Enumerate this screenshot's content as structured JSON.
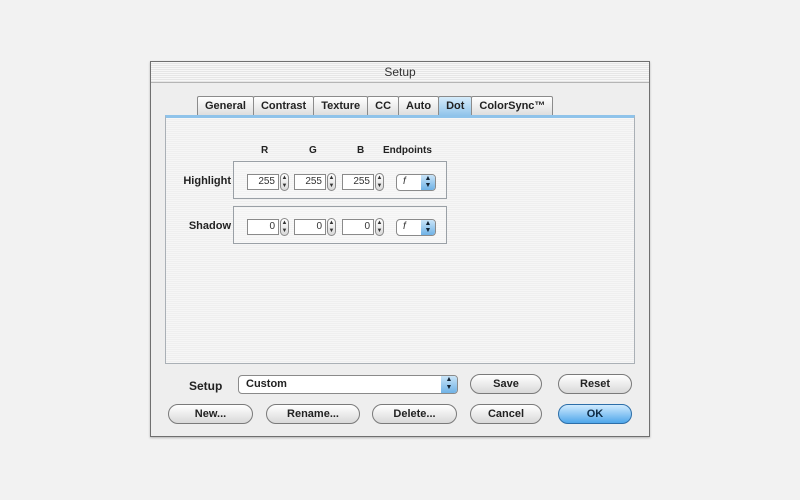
{
  "window": {
    "title": "Setup"
  },
  "tabs": [
    {
      "label": "General",
      "active": false
    },
    {
      "label": "Contrast",
      "active": false
    },
    {
      "label": "Texture",
      "active": false
    },
    {
      "label": "CC",
      "active": false
    },
    {
      "label": "Auto",
      "active": false
    },
    {
      "label": "Dot",
      "active": true
    },
    {
      "label": "ColorSync™",
      "active": false
    }
  ],
  "dot_panel": {
    "columns": {
      "r": "R",
      "g": "G",
      "b": "B",
      "endpoints": "Endpoints"
    },
    "highlight": {
      "label": "Highlight",
      "r": "255",
      "g": "255",
      "b": "255",
      "endpoint": "f"
    },
    "shadow": {
      "label": "Shadow",
      "r": "0",
      "g": "0",
      "b": "0",
      "endpoint": "f"
    }
  },
  "setup": {
    "label": "Setup",
    "selected": "Custom"
  },
  "buttons": {
    "save": "Save",
    "reset": "Reset",
    "new": "New...",
    "rename": "Rename...",
    "delete": "Delete...",
    "cancel": "Cancel",
    "ok": "OK"
  },
  "colors": {
    "accent": "#8fc3ea",
    "default_button": "#4ea6ea"
  }
}
